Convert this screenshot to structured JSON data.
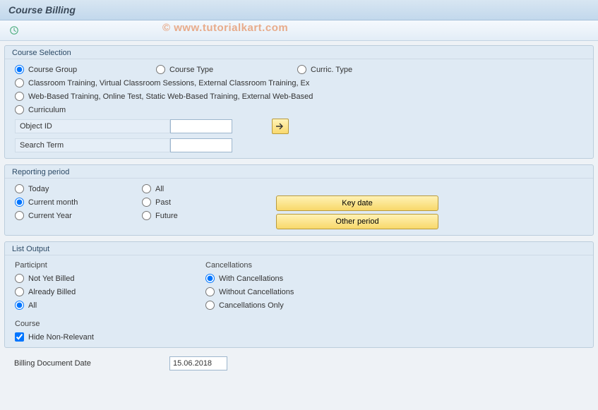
{
  "title": "Course Billing",
  "watermark": "© www.tutorialkart.com",
  "course_selection": {
    "legend": "Course Selection",
    "opts": {
      "group": "Course Group",
      "type": "Course Type",
      "curric": "Curric. Type",
      "classroom": "Classroom Training, Virtual Classroom Sessions, External Classroom Training, Ex",
      "webbased": "Web-Based Training, Online Test, Static Web-Based Training, External Web-Based",
      "curriculum": "Curriculum"
    },
    "object_id_label": "Object ID",
    "object_id_value": "",
    "search_term_label": "Search Term",
    "search_term_value": ""
  },
  "reporting_period": {
    "legend": "Reporting period",
    "col1": {
      "today": "Today",
      "month": "Current month",
      "year": "Current Year"
    },
    "col2": {
      "all": "All",
      "past": "Past",
      "future": "Future"
    },
    "btn_key": "Key date",
    "btn_other": "Other period"
  },
  "list_output": {
    "legend": "List Output",
    "participant_head": "Particip­nt",
    "participant": {
      "not_billed": "Not Yet Billed",
      "already": "Already Billed",
      "all": "All"
    },
    "cancel_head": "Cancellations",
    "cancel": {
      "with": "With Cancellations",
      "without": "Without Cancellations",
      "only": "Cancellations Only"
    },
    "course_head": "Course",
    "hide_nonrel": "Hide Non-Relevant"
  },
  "billing_date_label": "Billing Document Date",
  "billing_date_value": "15.06.2018"
}
